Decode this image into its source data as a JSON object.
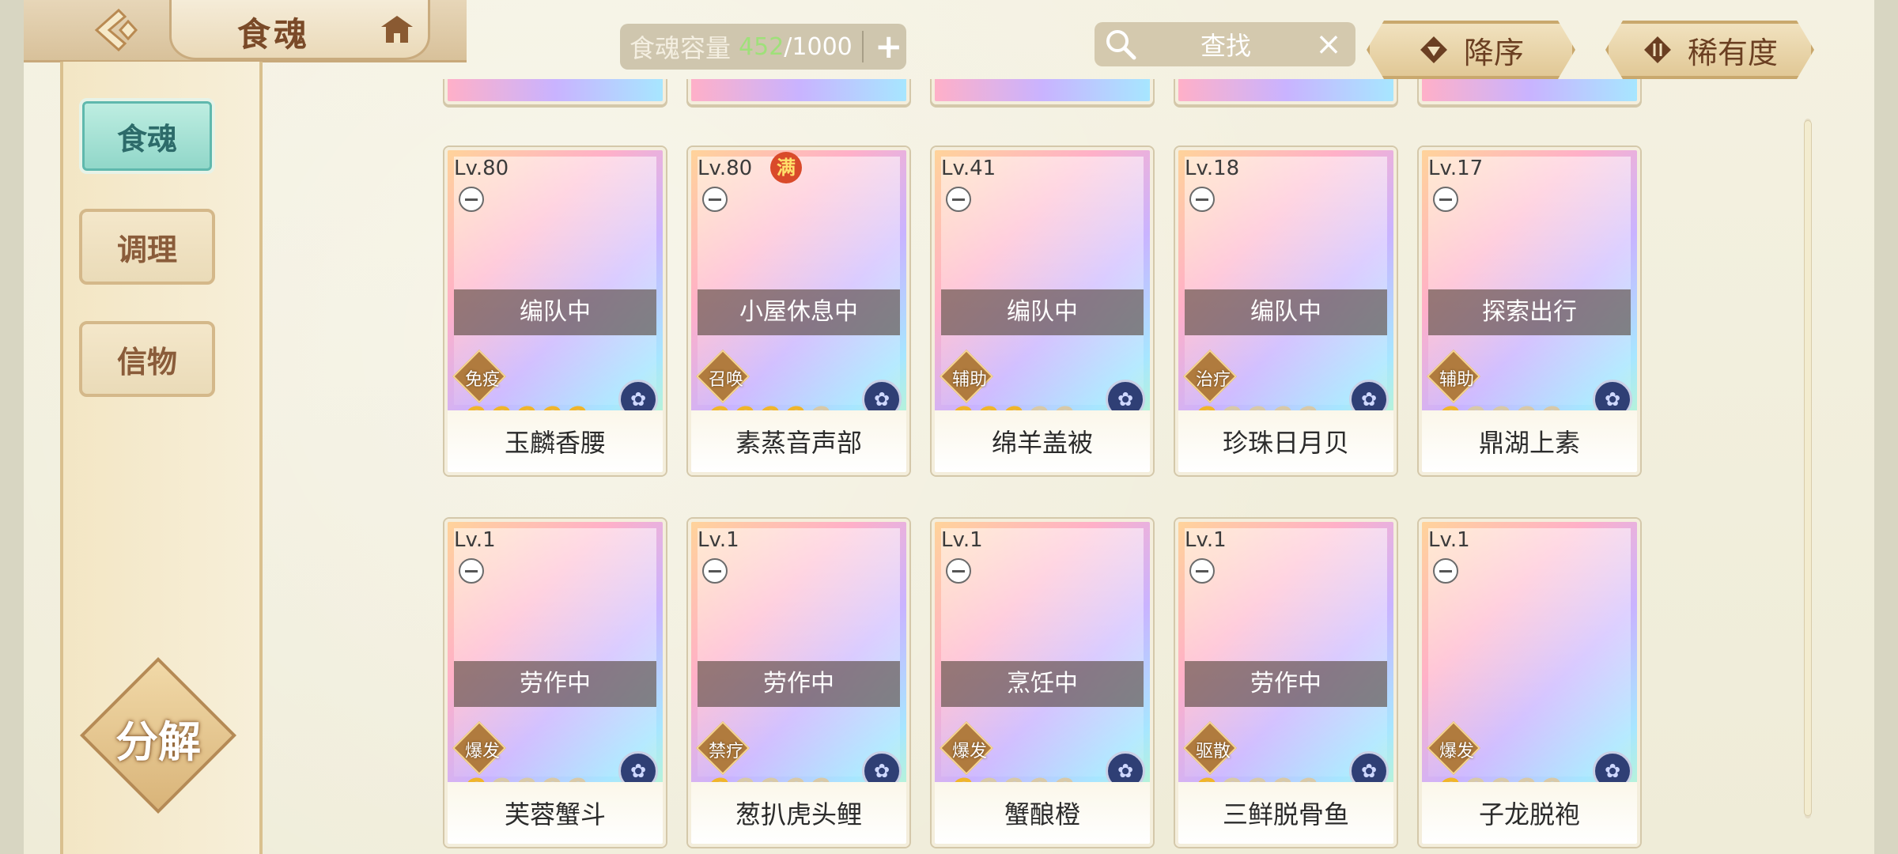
{
  "header": {
    "title": "食魂",
    "capacity_label": "食魂容量",
    "capacity_current": "452",
    "capacity_max": "/1000",
    "capacity_add": "+",
    "search_placeholder": "查找",
    "clear": "×",
    "sort_order_label": "降序",
    "sort_by_label": "稀有度"
  },
  "sidebar": {
    "items": [
      {
        "label": "食魂",
        "active": true
      },
      {
        "label": "调理",
        "active": false
      },
      {
        "label": "信物",
        "active": false
      }
    ],
    "decompose_label": "分解"
  },
  "colors": {
    "accent_teal": "#8fd6c8",
    "capacity_green": "#9fe07a",
    "brown_text": "#7a4a28",
    "star_gold": "#f0b52a"
  },
  "cards": [
    {
      "level": "Lv.80",
      "full": false,
      "status": "编队中",
      "role": "免疫",
      "stars": 5,
      "name": "玉麟香腰"
    },
    {
      "level": "Lv.80",
      "full": true,
      "full_label": "满",
      "status": "小屋休息中",
      "role": "召唤",
      "stars": 4,
      "name": "素蒸音声部"
    },
    {
      "level": "Lv.41",
      "full": false,
      "status": "编队中",
      "role": "辅助",
      "stars": 3,
      "name": "绵羊盖被"
    },
    {
      "level": "Lv.18",
      "full": false,
      "status": "编队中",
      "role": "治疗",
      "stars": 1,
      "name": "珍珠日月贝"
    },
    {
      "level": "Lv.17",
      "full": false,
      "status": "探索出行",
      "role": "辅助",
      "stars": 1,
      "name": "鼎湖上素"
    },
    {
      "level": "Lv.1",
      "full": false,
      "status": "劳作中",
      "role": "爆发",
      "stars": 1,
      "name": "芙蓉蟹斗"
    },
    {
      "level": "Lv.1",
      "full": false,
      "status": "劳作中",
      "role": "禁疗",
      "stars": 1,
      "name": "葱扒虎头鲤"
    },
    {
      "level": "Lv.1",
      "full": false,
      "status": "烹饪中",
      "role": "爆发",
      "stars": 1,
      "name": "蟹酿橙"
    },
    {
      "level": "Lv.1",
      "full": false,
      "status": "劳作中",
      "role": "驱散",
      "stars": 1,
      "name": "三鲜脱骨鱼"
    },
    {
      "level": "Lv.1",
      "full": false,
      "status": "",
      "role": "爆发",
      "stars": 1,
      "name": "子龙脱袍"
    }
  ]
}
